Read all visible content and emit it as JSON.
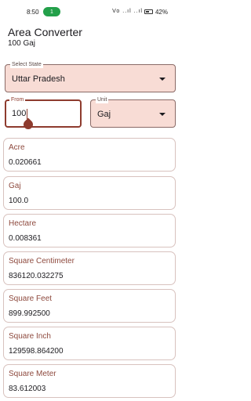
{
  "status": {
    "time": "8:50",
    "chip": "1",
    "signal_icons": "Vo ..ıl ..ıl",
    "battery": "42%"
  },
  "app": {
    "title": "Area Converter",
    "subtitle": "100 Gaj"
  },
  "state_select": {
    "label": "Select State",
    "value": "Uttar Pradesh"
  },
  "from_input": {
    "label": "From",
    "value": "100"
  },
  "unit_select": {
    "label": "Unit",
    "value": "Gaj"
  },
  "results": [
    {
      "unit": "Acre",
      "value": "0.020661"
    },
    {
      "unit": "Gaj",
      "value": "100.0"
    },
    {
      "unit": "Hectare",
      "value": "0.008361"
    },
    {
      "unit": "Square Centimeter",
      "value": "836120.032275"
    },
    {
      "unit": "Square Feet",
      "value": "899.992500"
    },
    {
      "unit": "Square Inch",
      "value": "129598.864200"
    },
    {
      "unit": "Square Meter",
      "value": "83.612003"
    }
  ],
  "colors": {
    "accent": "#8e3b2e",
    "field_fill": "#f8dcd5",
    "label": "#8e4a3e"
  }
}
